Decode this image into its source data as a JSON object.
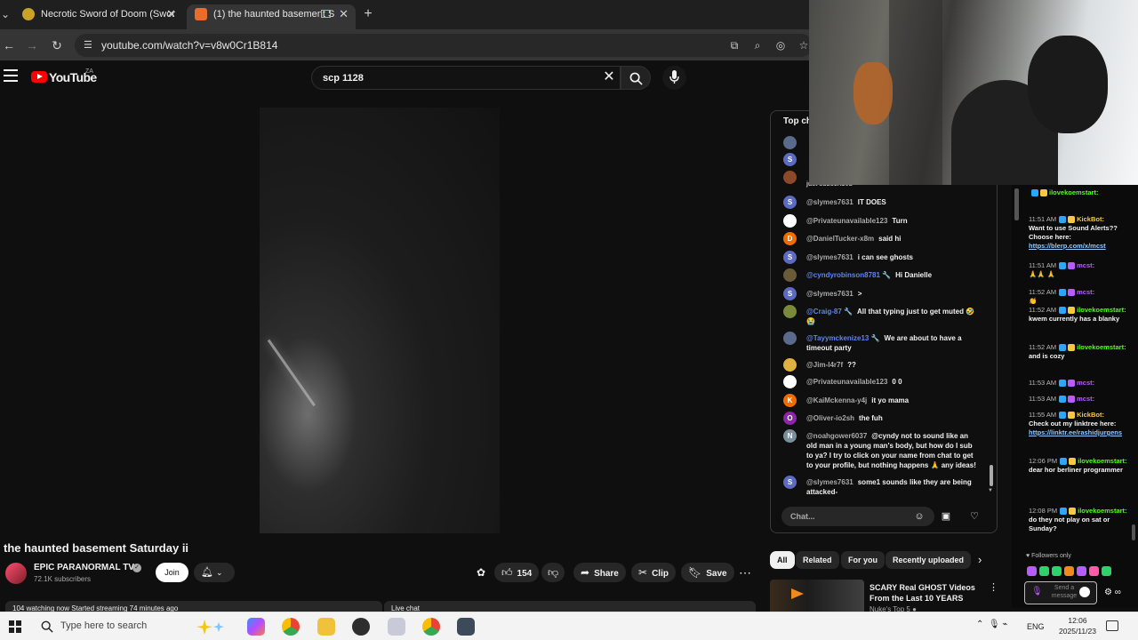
{
  "browser": {
    "tabs": [
      {
        "title": "Necrotic Sword of Doom (Swor",
        "active": false
      },
      {
        "title": "(1) the haunted basement S",
        "active": true
      }
    ],
    "url": "youtube.com/watch?v=v8w0Cr1B814"
  },
  "youtube": {
    "logo_text": "YouTube",
    "region": "ZA",
    "search_query": "scp 1128",
    "video": {
      "title": "the haunted basement Saturday ii",
      "channel": "EPIC PARANORMAL TV",
      "subscribers": "72.1K subscribers",
      "join_label": "Join",
      "likes": "154",
      "share_label": "Share",
      "clip_label": "Clip",
      "save_label": "Save",
      "watching_text": "104 watching now  Started streaming 74 minutes ago",
      "livechat_label": "Live chat"
    },
    "chat": {
      "header": "Top ch",
      "partial_text": "just subscribed",
      "input_placeholder": "Chat...",
      "messages": [
        {
          "initial": "S",
          "color": "#5c6bc0",
          "author": "@slymes7631",
          "mod": false,
          "text": "IT DOES"
        },
        {
          "initial": "",
          "color": "#ffffff",
          "author": "@Privateunavailable123",
          "mod": false,
          "text": "Turn"
        },
        {
          "initial": "D",
          "color": "#ef6c00",
          "author": "@DanielTucker-x8m",
          "mod": false,
          "text": "said hi"
        },
        {
          "initial": "S",
          "color": "#5c6bc0",
          "author": "@slymes7631",
          "mod": false,
          "text": "i can see ghosts"
        },
        {
          "initial": "",
          "color": "#6b5a3a",
          "author": "@cyndyrobinson8781 🔧",
          "mod": true,
          "text": "Hi Danielle"
        },
        {
          "initial": "S",
          "color": "#5c6bc0",
          "author": "@slymes7631",
          "mod": false,
          "text": ">"
        },
        {
          "initial": "",
          "color": "#7a8a3a",
          "author": "@Craig-87 🔧",
          "mod": true,
          "text": "All that typing just to get muted 🤣 😭"
        },
        {
          "initial": "",
          "color": "#5a6a8a",
          "author": "@Tayymckenize13 🔧",
          "mod": true,
          "text": "We are about to have a timeout party"
        },
        {
          "initial": "",
          "color": "#e0b040",
          "author": "@Jim-l4r7f",
          "mod": false,
          "text": "??"
        },
        {
          "initial": "",
          "color": "#ffffff",
          "author": "@Privateunavailable123",
          "mod": false,
          "text": "0 0"
        },
        {
          "initial": "K",
          "color": "#ef6c00",
          "author": "@KaiMckenna-y4j",
          "mod": false,
          "text": "it yo mama"
        },
        {
          "initial": "O",
          "color": "#8e24aa",
          "author": "@Oliver-io2sh",
          "mod": false,
          "text": "the fuh"
        },
        {
          "initial": "N",
          "color": "#78909c",
          "author": "@noahgower6037",
          "mod": false,
          "text": "@cyndy not to sound like an old man in a young man's body, but how do I sub to ya? I try to click on your name from chat to get to your profile, but nothing happens 🙏 any ideas!"
        },
        {
          "initial": "S",
          "color": "#5c6bc0",
          "author": "@slymes7631",
          "mod": false,
          "text": "some1 sounds like they are being attacked-"
        }
      ]
    },
    "chips": [
      "All",
      "Related",
      "For you",
      "Recently uploaded"
    ],
    "recommendation": {
      "title": "SCARY Real GHOST Videos From the Last 10 YEARS",
      "channel": "Nuke's Top 5 ●"
    }
  },
  "kick_chat": {
    "messages": [
      {
        "time": "",
        "user": "ilovekoemstart:",
        "cls": "",
        "text": ""
      },
      {
        "time": "11:51 AM",
        "user": "KickBot:",
        "cls": "k",
        "text": "Want to use Sound Alerts?? Choose here:",
        "link": "https://blerp.com/x/mcst"
      },
      {
        "time": "11:51 AM",
        "user": "mcst:",
        "cls": "m",
        "text": "🙏🙏 🙏"
      },
      {
        "time": "11:52 AM",
        "user": "mcst:",
        "cls": "m",
        "text": "👏"
      },
      {
        "time": "11:52 AM",
        "user": "ilovekoemstart:",
        "cls": "",
        "text": "kwem currently has a blanky"
      },
      {
        "time": "11:52 AM",
        "user": "ilovekoemstart:",
        "cls": "",
        "text": "and is cozy"
      },
      {
        "time": "11:53 AM",
        "user": "mcst:",
        "cls": "m",
        "text": ""
      },
      {
        "time": "11:53 AM",
        "user": "mcst:",
        "cls": "m",
        "text": ""
      },
      {
        "time": "11:55 AM",
        "user": "KickBot:",
        "cls": "k",
        "text": "Check out my linktree here:",
        "link": "https://linktr.ee/rashidjurgens"
      },
      {
        "time": "12:06 PM",
        "user": "ilovekoemstart:",
        "cls": "",
        "text": "dear hor berliner programmer"
      },
      {
        "time": "12:08 PM",
        "user": "ilovekoemstart:",
        "cls": "",
        "text": "do they not play on sat or Sunday?"
      }
    ],
    "followers_only": "Followers only",
    "input_placeholder": "Send a message"
  },
  "taskbar": {
    "search_placeholder": "Type here to search",
    "language": "ENG",
    "time": "12:06",
    "date": "2025/11/23"
  }
}
